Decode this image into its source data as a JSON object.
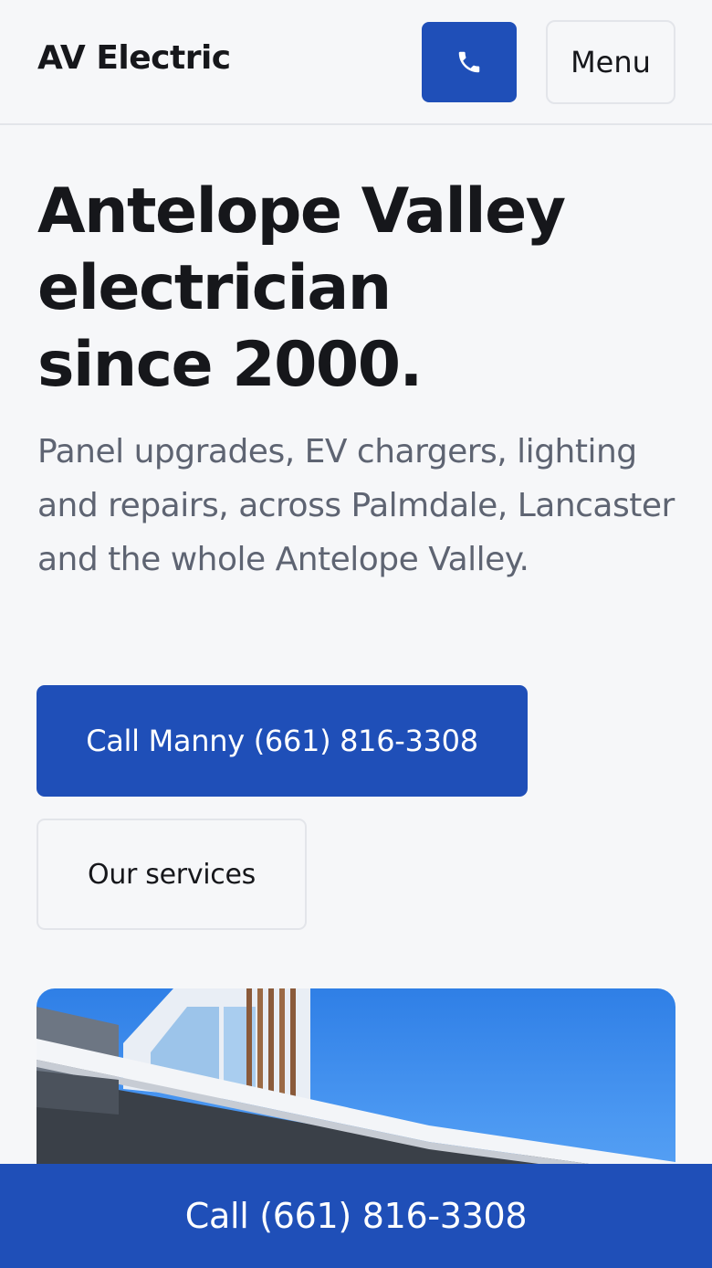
{
  "header": {
    "brand": "AV Electric",
    "phone_icon": "phone-icon",
    "menu_label": "Menu"
  },
  "hero": {
    "title_lines": [
      "Antelope Valley",
      "electrician",
      "since 2000."
    ],
    "subtitle": "Panel upgrades, EV chargers, lighting and repairs, across Palmdale, Lancaster and the whole Antelope Valley.",
    "primary_cta": "Call Manny (661) 816-3308",
    "secondary_cta": "Our services"
  },
  "sticky_bar": {
    "label": "Call (661) 816-3308"
  },
  "colors": {
    "accent": "#1f4fb8",
    "background": "#f6f7f9",
    "text": "#16171b",
    "muted_text": "#5e6472",
    "border": "#e3e5ea"
  }
}
